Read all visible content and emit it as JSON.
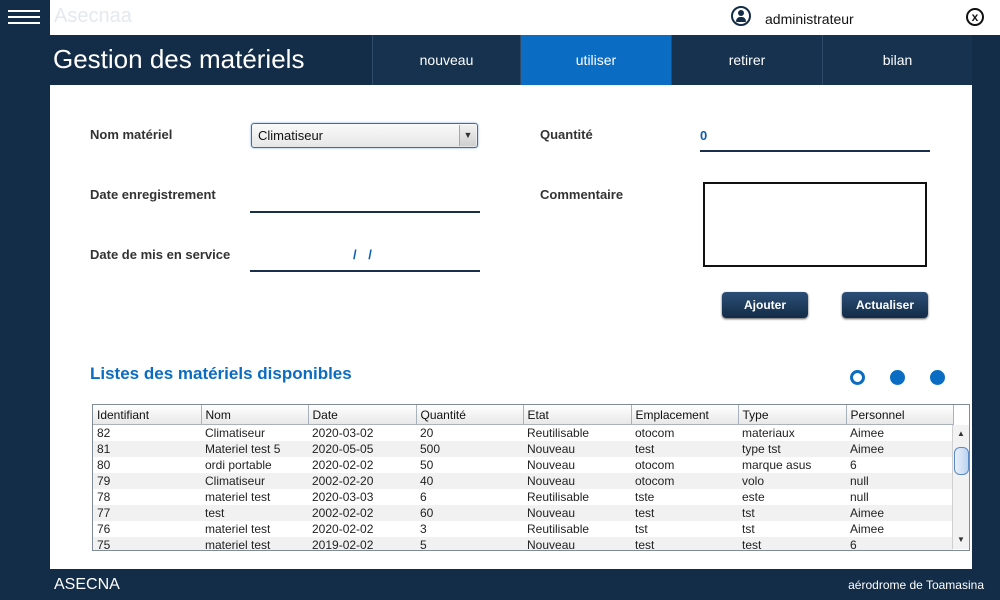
{
  "app": {
    "ghost_title": "Asecnaa",
    "user_name": "administrateur",
    "page_title": "Gestion des matériels"
  },
  "tabs": [
    {
      "label": "nouveau",
      "active": false
    },
    {
      "label": "utiliser",
      "active": true
    },
    {
      "label": "retirer",
      "active": false
    },
    {
      "label": "bilan",
      "active": false
    }
  ],
  "form": {
    "nom_label": "Nom matériel",
    "nom_value": "Climatiseur",
    "date_enreg_label": "Date enregistrement",
    "date_enreg_value": "",
    "date_service_label": "Date de mis en service",
    "date_service_value": "/ /",
    "quantite_label": "Quantité",
    "quantite_value": "0",
    "commentaire_label": "Commentaire",
    "commentaire_value": ""
  },
  "buttons": {
    "add": "Ajouter",
    "refresh": "Actualiser"
  },
  "list": {
    "title": "Listes des matériels disponibles",
    "columns": [
      "Identifiant",
      "Nom",
      "Date",
      "Quantité",
      "Etat",
      "Emplacement",
      "Type",
      "Personnel"
    ],
    "rows": [
      [
        "82",
        "Climatiseur",
        "2020-03-02",
        "20",
        "Reutilisable",
        "otocom",
        "materiaux",
        "Aimee"
      ],
      [
        "81",
        "Materiel test 5",
        "2020-05-05",
        "500",
        "Nouveau",
        "test",
        "type tst",
        "Aimee"
      ],
      [
        "80",
        "ordi portable",
        "2020-02-02",
        "50",
        "Nouveau",
        "otocom",
        "marque asus",
        "6"
      ],
      [
        "79",
        "Climatiseur",
        "2002-02-20",
        "40",
        "Nouveau",
        "otocom",
        "volo",
        "null"
      ],
      [
        "78",
        "materiel test",
        "2020-03-03",
        "6",
        "Reutilisable",
        "tste",
        "este",
        "null"
      ],
      [
        "77",
        "test",
        "2002-02-02",
        "60",
        "Nouveau",
        "test",
        "tst",
        "Aimee"
      ],
      [
        "76",
        "materiel test",
        "2020-02-02",
        "3",
        "Reutilisable",
        "tst",
        "tst",
        "Aimee"
      ],
      [
        "75",
        "materiel test",
        "2019-02-02",
        "5",
        "Nouveau",
        "test",
        "test",
        "6"
      ]
    ]
  },
  "footer": {
    "left": "ASECNA",
    "right": "aérodrome de Toamasina"
  },
  "colors": {
    "navy": "#132c47",
    "accent": "#0a6cc2"
  },
  "icons": {
    "menu": "hamburger-icon",
    "user": "user-icon",
    "close": "close-icon"
  }
}
